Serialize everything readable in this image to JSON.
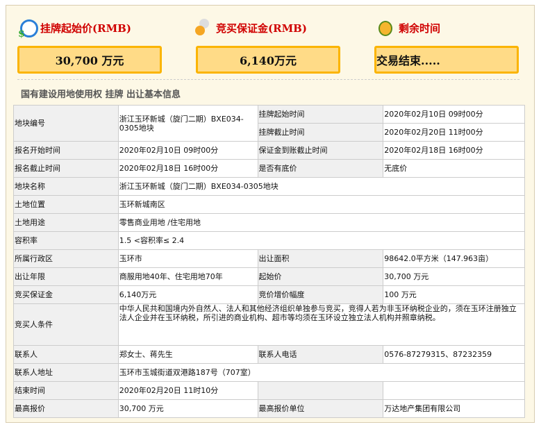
{
  "header": {
    "start_price_label": "挂牌起始价(RMB)",
    "deposit_label": "竞买保证金(RMB)",
    "remaining_label": "剩余时间",
    "start_price_value": "30,700 万元",
    "deposit_value": "6,140万元",
    "remaining_value": "交易结束....."
  },
  "section_title": "国有建设用地使用权 挂牌 出让基本信息",
  "table": {
    "r1": {
      "l1": "地块编号",
      "v1": "浙江玉环新城（旋门二期）BXE034-0305地块",
      "l2a": "挂牌起始时间",
      "v2a": "2020年02月10日 09时00分",
      "l2b": "挂牌截止时间",
      "v2b": "2020年02月20日 11时00分"
    },
    "r2": {
      "l1": "报名开始时间",
      "v1": "2020年02月10日 09时00分",
      "l2": "保证金到账截止时间",
      "v2": "2020年02月18日 16时00分"
    },
    "r3": {
      "l1": "报名截止时间",
      "v1": "2020年02月18日 16时00分",
      "l2": "是否有底价",
      "v2": "无底价"
    },
    "r4": {
      "l1": "地块名称",
      "v1": "浙江玉环新城（旋门二期）BXE034-0305地块"
    },
    "r5": {
      "l1": "土地位置",
      "v1": "玉环新城南区"
    },
    "r6": {
      "l1": "土地用途",
      "v1": "零售商业用地 /住宅用地"
    },
    "r7": {
      "l1": "容积率",
      "v1": "1.5 <容积率≤ 2.4"
    },
    "r8": {
      "l1": "所属行政区",
      "v1": "玉环市",
      "l2": "出让面积",
      "v2": "98642.0平方米（147.963亩）"
    },
    "r9": {
      "l1": "出让年限",
      "v1": "商服用地40年、住宅用地70年",
      "l2": "起始价",
      "v2": "30,700 万元"
    },
    "r10": {
      "l1": "竞买保证金",
      "v1": "6,140万元",
      "l2": "竞价增价幅度",
      "v2": "100 万元"
    },
    "r11": {
      "l1": "竞买人条件",
      "v1": "中华人民共和国境内外自然人、法人和其他经济组织单独参与竞买，竞得人若为非玉环纳税企业的，须在玉环注册独立法人企业并在玉环纳税，所引进的商业机构、超市等均须在玉环设立独立法人机构并照章纳税。"
    },
    "r12": {
      "l1": "联系人",
      "v1": "郑女士、蒋先生",
      "l2": "联系人电话",
      "v2": "0576-87279315、87232359"
    },
    "r13": {
      "l1": "联系人地址",
      "v1": "玉环市玉城街道双港路187号（707室）"
    },
    "r14": {
      "l1": "结束时间",
      "v1": "2020年02月20日 11时10分"
    },
    "r15": {
      "l1": "最高报价",
      "v1": "30,700 万元",
      "l2": "最高报价单位",
      "v2": "万达地产集团有限公司"
    }
  }
}
